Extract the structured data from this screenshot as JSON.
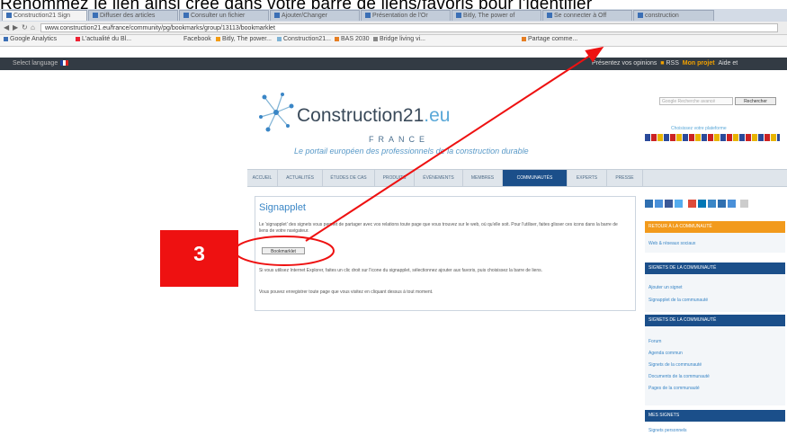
{
  "caption": "Renommez le lien ainsi créé dans votre barre de liens/favoris pour l'identifier",
  "browser": {
    "tabs": [
      {
        "label": "Construction21 Sign",
        "active": true
      },
      {
        "label": "Diffuser des articles",
        "active": false
      },
      {
        "label": "Consulter un fichier",
        "active": false
      },
      {
        "label": "Ajouter/Changer",
        "active": false
      },
      {
        "label": "Présentation de l'Or",
        "active": false
      },
      {
        "label": "Bitly, The power of",
        "active": false
      },
      {
        "label": "Se connecter à Off",
        "active": false
      },
      {
        "label": "construction",
        "active": false
      }
    ],
    "url": "www.construction21.eu/france/community/pg/bookmarks/group/13113/bookmarklet",
    "bookmarks": [
      "Google Analytics",
      "L'actualité du Bl...",
      "Facebook",
      "Bitly, The power...",
      "Construction21...",
      "BAS 2030",
      "Bridge living vi...",
      "Partage comme..."
    ]
  },
  "site_bar": {
    "lang_label": "Select language",
    "right_text": "Présentez vos opinions",
    "rss": "RSS",
    "user": "Mon projet",
    "extra": "Aide et"
  },
  "header": {
    "logo_main": "Construction21",
    "logo_eu": ".eu",
    "france": "FRANCE",
    "tagline": "Le portail européen des professionnels de la construction durable",
    "search_placeholder": "Google Recherche avancé",
    "search_button": "Rechercher",
    "choose_lang": "Choisissez votre plateforme"
  },
  "nav": {
    "items": [
      "ACCUEIL",
      "ACTUALITÉS",
      "ÉTUDES DE CAS",
      "PRODUITS",
      "ÉVÉNEMENTS",
      "MEMBRES",
      "COMMUNAUTÉS",
      "EXPERTS",
      "PRESSE"
    ],
    "active_index": 6
  },
  "content": {
    "title": "Signapplet",
    "p1": "Le 'signapplet' des signets vous permet de partager avec vos relations toute page que vous trouvez sur le web, où qu'elle soit. Pour l'utiliser, faites glisser ces icons dans la barre de liens de votre navigateur.",
    "bookmarklet_label": "Bookmarklet",
    "p2": "Si vous utilisez Internet Explorer, faites un clic droit sur l'icone du signapplet, sélectionnez ajouter aux favoris, puis choisissez la barre de liens.",
    "p3": "Vous pouvez enregistrer toute page que vous visitez en cliquant dessus à tout moment."
  },
  "sidebar": {
    "section1": {
      "title": "RETOUR À LA COMMUNAUTÉ",
      "links": [
        "Web & réseaux sociaux"
      ]
    },
    "section2": {
      "title": "SIGNETS DE LA COMMUNAUTÉ",
      "links": [
        "Ajouter un signet",
        "Signapplet de la communauté"
      ]
    },
    "section3": {
      "title": "SIGNETS DE LA COMMUNAUTÉ",
      "links": [
        "Forum",
        "Agenda commun",
        "Signets de la communauté",
        "Documents de la communauté",
        "Pages de la communauté"
      ]
    },
    "section4": {
      "title": "MES SIGNETS",
      "links": [
        "Signets personnels"
      ]
    }
  },
  "annotation": {
    "step_number": "3"
  },
  "colors": {
    "accent": "#1b4f8a",
    "link": "#3a86c6",
    "badge": "#ee1111",
    "arrow": "#ee1111"
  }
}
